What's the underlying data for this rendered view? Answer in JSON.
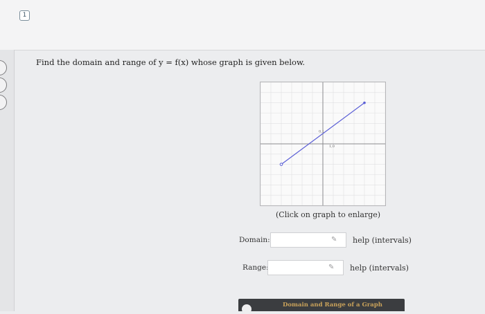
{
  "question": {
    "number": "1",
    "prompt": "Find the domain and range of y = f(x) whose graph is given below."
  },
  "graph": {
    "caption": "(Click on graph to enlarge)",
    "x_tick_label": "1,0",
    "y_tick_label": "0,1",
    "line_start": [
      -4,
      -2
    ],
    "line_end": [
      4,
      4
    ],
    "start_point_open": true,
    "end_point_closed": true,
    "x_range": [
      -6,
      6
    ],
    "y_range": [
      -6,
      6
    ],
    "line_color": "#5b5fd6"
  },
  "domain": {
    "label": "Domain:",
    "value": "",
    "help": "help (intervals)"
  },
  "range": {
    "label": "Range:",
    "value": "",
    "help": "help (intervals)"
  },
  "footer": {
    "label": "Domain and Range of a Graph"
  }
}
